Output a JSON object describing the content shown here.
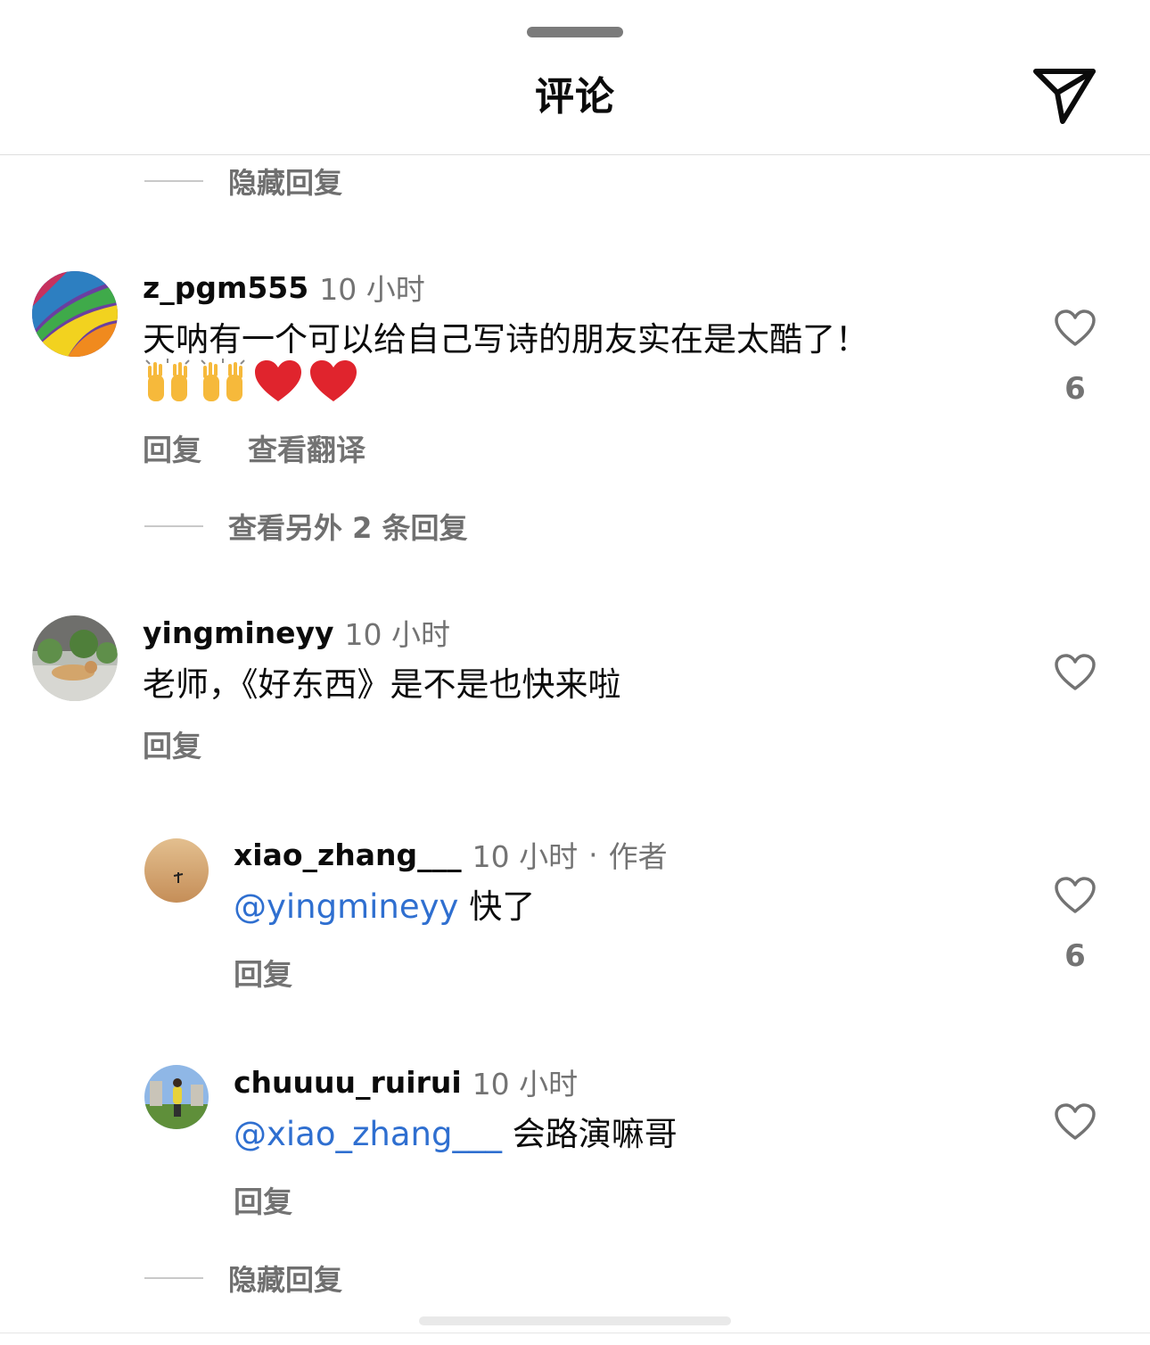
{
  "header": {
    "title": "评论"
  },
  "hide_replies_top": "隐藏回复",
  "comments": [
    {
      "username": "z_pgm555",
      "time": "10 小时",
      "text": "天呐有一个可以给自己写诗的朋友实在是太酷了！",
      "emojis": [
        "raising-hands",
        "raising-hands",
        "red-heart",
        "red-heart"
      ],
      "reply_label": "回复",
      "translate_label": "查看翻译",
      "likes": "6",
      "view_more_replies": "查看另外 2 条回复"
    },
    {
      "username": "yingmineyy",
      "time": "10 小时",
      "text": "老师，《好东西》是不是也快来啦",
      "reply_label": "回复",
      "replies": [
        {
          "username": "xiao_zhang___",
          "time": "10 小时",
          "dot": "·",
          "badge": "作者",
          "mention": "@yingmineyy",
          "text": " 快了",
          "reply_label": "回复",
          "likes": "6"
        },
        {
          "username": "chuuuu_ruirui",
          "time": "10 小时",
          "mention": "@xiao_zhang___",
          "text": " 会路演嘛哥",
          "reply_label": "回复"
        }
      ],
      "hide_replies": "隐藏回复"
    }
  ]
}
